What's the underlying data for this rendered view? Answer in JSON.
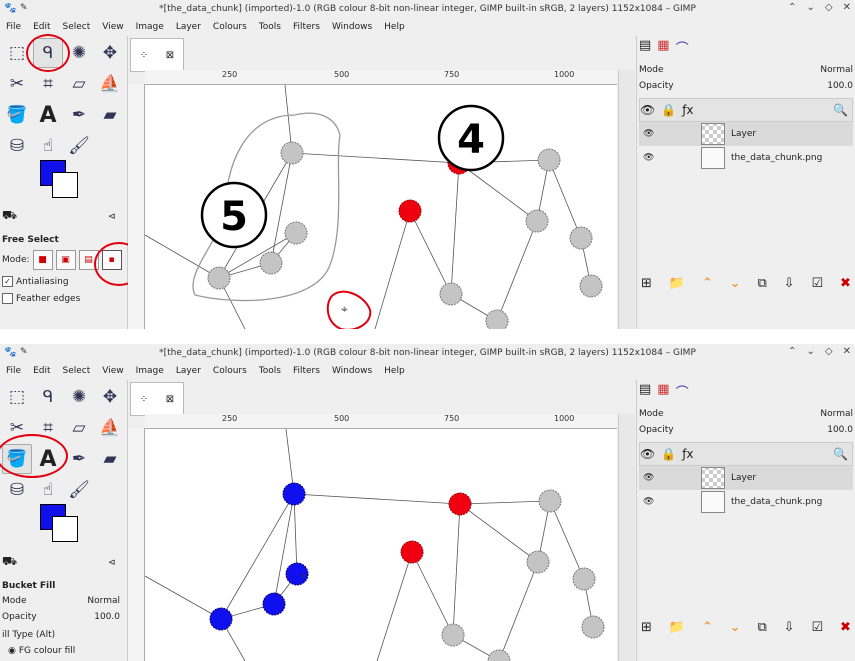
{
  "panels": [
    {
      "title": "*[the_data_chunk] (imported)-1.0 (RGB colour 8-bit non-linear integer, GIMP built-in sRGB, 2 layers) 1152x1084 – GIMP",
      "menu": [
        "File",
        "Edit",
        "Select",
        "View",
        "Image",
        "Layer",
        "Colours",
        "Tools",
        "Filters",
        "Windows",
        "Help"
      ],
      "active_tool": "free-select",
      "tool_options": {
        "title": "Free Select",
        "mode_label": "Mode:",
        "antialiasing": "Antialiasing",
        "feather": "Feather edges"
      },
      "ruler_labels": [
        "250",
        "500",
        "750",
        "1000"
      ],
      "annotations": [
        "4",
        "5"
      ]
    },
    {
      "title": "*[the_data_chunk] (imported)-1.0 (RGB colour 8-bit non-linear integer, GIMP built-in sRGB, 2 layers) 1152x1084 – GIMP",
      "menu": [
        "File",
        "Edit",
        "Select",
        "View",
        "Image",
        "Layer",
        "Colours",
        "Tools",
        "Filters",
        "Windows",
        "Help"
      ],
      "active_tool": "bucket-fill",
      "tool_options": {
        "title": "Bucket Fill",
        "mode_label": "Mode",
        "mode_value": "Normal",
        "opacity_label": "Opacity",
        "opacity_value": "100.0",
        "fill_type_label": "ill Type  (Alt)",
        "fill_option": "FG colour fill"
      },
      "ruler_labels": [
        "250",
        "500",
        "750",
        "1000"
      ]
    }
  ],
  "layers_dock": {
    "mode_label": "Mode",
    "mode_value": "Normal",
    "opacity_label": "Opacity",
    "opacity_value": "100.0",
    "layers": [
      {
        "name": "Layer",
        "selected": true
      },
      {
        "name": "the_data_chunk.png",
        "selected": false
      }
    ]
  },
  "colors": {
    "foreground": "#1010e8",
    "annotation_red": "#e00010",
    "node_gray": "#c4c4c4",
    "node_red": "#ee0011",
    "node_blue": "#1010ee"
  }
}
